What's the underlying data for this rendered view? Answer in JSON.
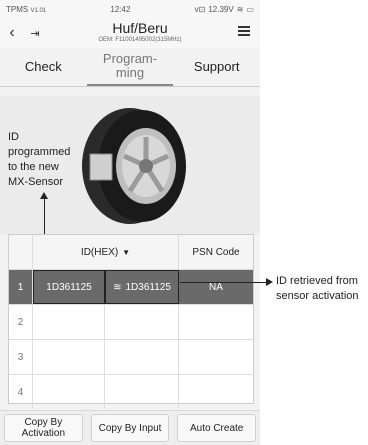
{
  "status": {
    "app": "TPMS",
    "version": "V1.01",
    "time": "12:42",
    "battery": "12.39V"
  },
  "header": {
    "title": "Huf/Beru",
    "subtitle": "OEM: F11001495002(315MHz)"
  },
  "tabs": [
    {
      "label": "Check"
    },
    {
      "label": "Program-\nming"
    },
    {
      "label": "Support"
    }
  ],
  "caption": "ID\nprogrammed\nto the new\nMX-Sensor",
  "table": {
    "headers": [
      "",
      "ID(HEX)",
      "▼",
      "PSN Code"
    ],
    "rows": [
      {
        "num": "1",
        "id": "1D361125",
        "read": "1D361125",
        "psn": "NA"
      },
      {
        "num": "2",
        "id": "",
        "read": "",
        "psn": ""
      },
      {
        "num": "3",
        "id": "",
        "read": "",
        "psn": ""
      },
      {
        "num": "4",
        "id": "",
        "read": "",
        "psn": ""
      }
    ]
  },
  "buttons": [
    {
      "label": "Copy By\nActivation"
    },
    {
      "label": "Copy By Input"
    },
    {
      "label": "Auto Create"
    }
  ],
  "callout": "ID retrieved from\nsensor activation"
}
